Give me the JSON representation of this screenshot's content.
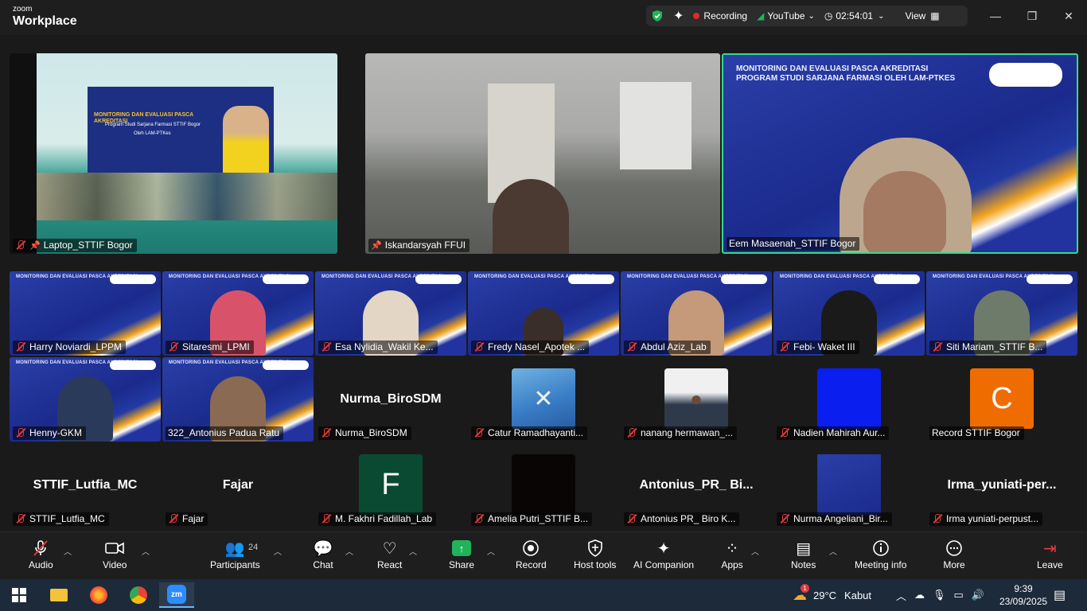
{
  "app": {
    "brand_small": "zoom",
    "brand_large": "Workplace"
  },
  "status": {
    "recording": "Recording",
    "youtube": "YouTube",
    "timer": "02:54:01",
    "view": "View"
  },
  "top_tiles": [
    {
      "name": "Laptop_STTIF Bogor",
      "muted": true,
      "pinned": true
    },
    {
      "name": "Iskandarsyah FFUI",
      "muted": false,
      "pinned": true
    },
    {
      "name": "Eem Masaenah_STTIF Bogor",
      "muted": false,
      "pinned": false
    }
  ],
  "banner": {
    "line1": "MONITORING DAN EVALUASI PASCA AKREDITASI",
    "line2": "Program Studi Sarjana Farmasi STTIF Bogor",
    "line3": "Oleh LAM-PTKes"
  },
  "slide": {
    "line1": "MONITORING DAN EVALUASI PASCA AKREDITASI",
    "line2": "PROGRAM STUDI SARJANA FARMASI OLEH LAM-PTKES"
  },
  "row1": [
    {
      "name": "Harry Noviardi_LPPM"
    },
    {
      "name": "Sitaresmi_LPMI"
    },
    {
      "name": "Esa Nylidia_Wakil Ke..."
    },
    {
      "name": "Fredy Nasel_Apotek ..."
    },
    {
      "name": "Abdul Aziz_Lab"
    },
    {
      "name": "Febi- Waket III"
    },
    {
      "name": "Siti Mariam_STTIF B..."
    }
  ],
  "row2": [
    {
      "name": "Henny-GKM",
      "muted": true
    },
    {
      "name": "322_Antonius Padua Ratu",
      "muted": false
    },
    {
      "name": "Nurma_BiroSDM",
      "display": "Nurma_BiroSDM",
      "muted": true
    },
    {
      "name": "Catur Ramadhayanti...",
      "muted": true
    },
    {
      "name": "nanang hermawan_...",
      "muted": true
    },
    {
      "name": "Nadien Mahirah Aur...",
      "muted": true
    },
    {
      "name": "Record STTIF Bogor",
      "letter": "C",
      "muted": false
    }
  ],
  "row3": [
    {
      "name": "STTIF_Lutfia_MC",
      "display": "STTIF_Lutfia_MC"
    },
    {
      "name": "Fajar",
      "display": "Fajar"
    },
    {
      "name": "M. Fakhri Fadillah_Lab",
      "letter": "F"
    },
    {
      "name": "Amelia Putri_STTIF B..."
    },
    {
      "name": "Antonius PR_ Biro K...",
      "display": "Antonius_PR_ Bi..."
    },
    {
      "name": "Nurma Angeliani_Bir..."
    },
    {
      "name": "Irma yuniati-perpust...",
      "display": "Irma_yuniati-per..."
    }
  ],
  "toolbar": {
    "audio": "Audio",
    "video": "Video",
    "participants": "Participants",
    "participants_count": "24",
    "chat": "Chat",
    "react": "React",
    "share": "Share",
    "record": "Record",
    "host_tools": "Host tools",
    "ai_companion": "AI Companion",
    "apps": "Apps",
    "notes": "Notes",
    "meeting_info": "Meeting info",
    "more": "More",
    "leave": "Leave"
  },
  "taskbar": {
    "weather_temp": "29°C",
    "weather_desc": "Kabut",
    "time": "9:39",
    "date": "23/09/2025",
    "weather_badge": "1"
  },
  "colors": {
    "accent_green": "#21b35a",
    "rec_red": "#e02828",
    "muted_red": "#e03a3a",
    "active_border": "#39d98a"
  }
}
